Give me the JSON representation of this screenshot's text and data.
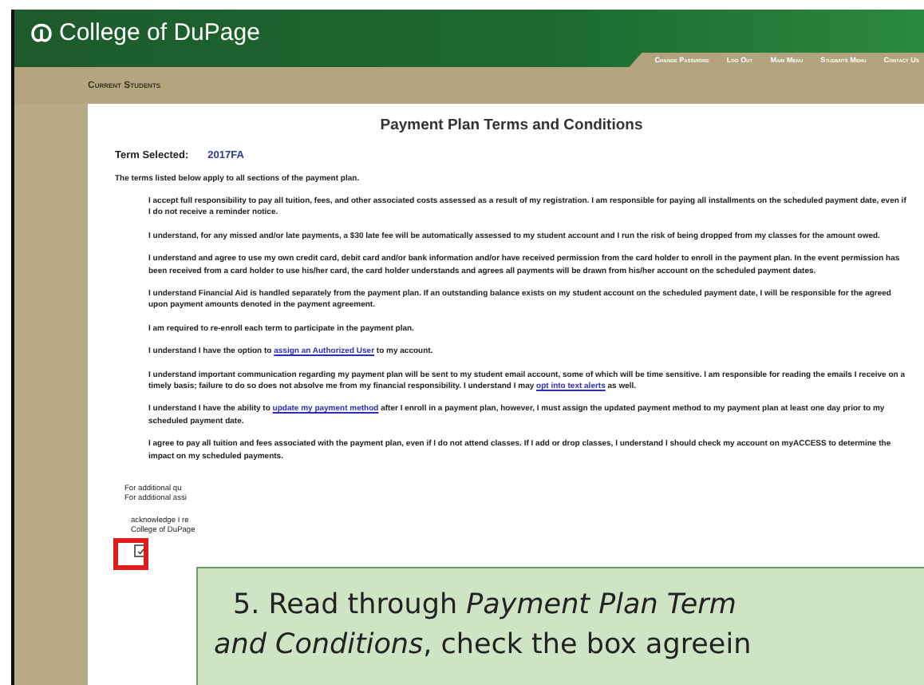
{
  "header": {
    "logo_text": "College of DuPage",
    "nav": [
      "Change Password",
      "Log Out",
      "Main Menu",
      "Students Menu",
      "Contact Us"
    ]
  },
  "section": {
    "title": "Current Students"
  },
  "page": {
    "title": "Payment Plan Terms and Conditions",
    "term_label": "Term Selected:",
    "term_value": "2017FA",
    "intro": "The terms listed below apply to all sections of the payment plan.",
    "terms": [
      {
        "parts": [
          {
            "text": "I accept full responsibility to pay all tuition, fees, and other associated costs assessed as a result of my registration. I am responsible for paying all installments on the scheduled payment date, even if I do not receive a reminder notice."
          }
        ]
      },
      {
        "parts": [
          {
            "text": "I understand, for any missed and/or late payments, a $30 late fee will be automatically assessed to my student account and I run the risk of being dropped from my classes for the amount owed."
          }
        ]
      },
      {
        "parts": [
          {
            "text": "I understand and agree to use my own credit card, debit card and/or bank information and/or have received permission from the card holder to enroll in the payment plan. In the event permission has been received from a card holder to use his/her card, the card holder understands and agrees all payments will be drawn from his/her account on the scheduled payment dates."
          }
        ]
      },
      {
        "parts": [
          {
            "text": "I understand Financial Aid is handled separately from the payment plan. If an outstanding balance exists on my student account on the scheduled payment date, I will be responsible for the agreed upon payment amounts denoted in the payment agreement."
          }
        ]
      },
      {
        "parts": [
          {
            "text": "I am required to re-enroll each term to participate in the payment plan."
          }
        ]
      },
      {
        "parts": [
          {
            "text": "I understand I have the option to "
          },
          {
            "text": "assign an Authorized User",
            "kind": "link"
          },
          {
            "text": " to my account."
          }
        ]
      },
      {
        "parts": [
          {
            "text": "I understand important communication regarding my payment plan will be sent to my student email account, some of which will be time sensitive. I am responsible for reading the emails I receive on a timely basis; failure to do so does not absolve me from my financial responsibility. I understand I may "
          },
          {
            "text": "opt into text alerts",
            "kind": "link"
          },
          {
            "text": " as well."
          }
        ]
      },
      {
        "parts": [
          {
            "text": "I understand I have the ability to "
          },
          {
            "text": "update my payment method",
            "kind": "link"
          },
          {
            "text": " after I enroll in a payment plan, however, I must assign the updated payment method to my payment plan at least one day prior to my scheduled payment date."
          }
        ]
      },
      {
        "parts": [
          {
            "text": "I agree to pay all tuition and fees associated with the payment plan, even if I do not attend classes. If I add or drop classes, I understand I should check my account on myACCESS to determine the impact on my scheduled payments."
          }
        ]
      }
    ],
    "footer_lines": [
      "For additional qu",
      "For additional assi"
    ],
    "agreement_lines": [
      "acknowledge I re",
      "College of DuPage"
    ],
    "agree_checkbox": {
      "checked": true
    }
  },
  "callout": {
    "lines": [
      "5. Read through *Payment Plan Term*",
      "*and Conditions*, check the box agreein"
    ]
  }
}
